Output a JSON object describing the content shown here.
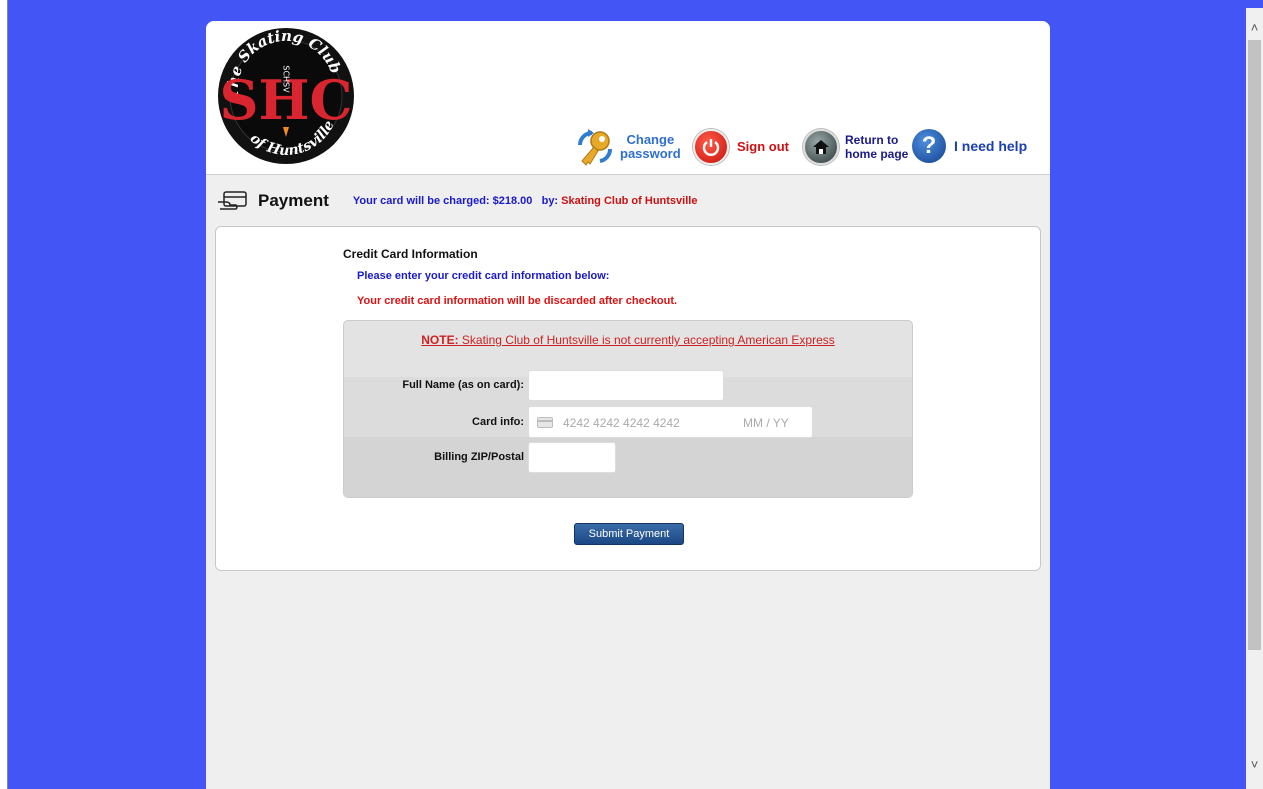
{
  "logo": {
    "top_text": "The Skating Club",
    "bottom_text": "of Huntsville",
    "initials": "SHC",
    "vertical_text": "SCHSV",
    "colors": {
      "ring": "#111111",
      "letters": "#d8252f",
      "arc_text": "#ffffff"
    }
  },
  "header": {
    "change_password": {
      "line1": "Change",
      "line2": "password",
      "icon": "key-icon"
    },
    "sign_out": {
      "label": "Sign out",
      "icon": "power-icon"
    },
    "return_home": {
      "line1": "Return to",
      "line2": "home page",
      "icon": "home-icon"
    },
    "help": {
      "label": "I need help",
      "icon": "question-icon"
    }
  },
  "payment": {
    "title": "Payment",
    "charge_prefix": "Your card will be charged:",
    "amount": "$218.00",
    "by_label": "by:",
    "organization": "Skating Club of Huntsville"
  },
  "credit_card": {
    "title": "Credit Card Information",
    "instruction": "Please enter your credit card information below:",
    "warning": "Your credit card information will be discarded after checkout.",
    "note_label": "NOTE:",
    "note_text": "Skating Club of Huntsville is not currently accepting American Express",
    "full_name_label": "Full Name (as on card):",
    "full_name_value": "",
    "card_info_label": "Card info:",
    "card_number_placeholder": "4242 4242 4242 4242",
    "expiry_placeholder": "MM / YY",
    "zip_label": "Billing ZIP/Postal",
    "zip_value": "",
    "submit_label": "Submit Payment"
  },
  "colors": {
    "page_background": "#4455f5",
    "link_blue": "#1a1acc",
    "alert_red": "#dd1111"
  }
}
